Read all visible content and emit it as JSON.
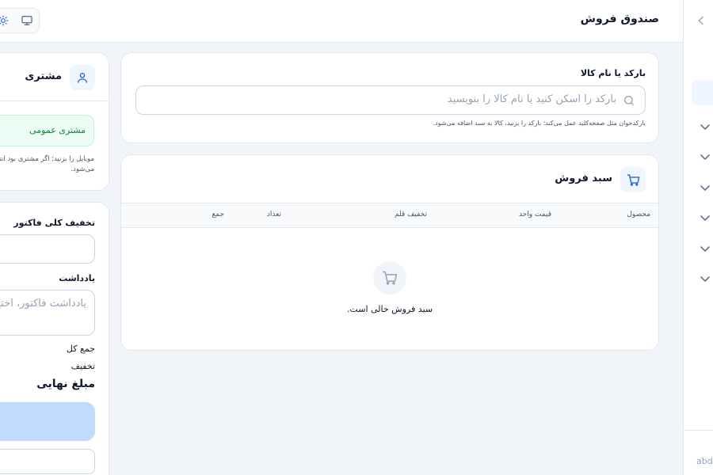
{
  "header": {
    "title": "صندوق فروش",
    "mode_toggle": {
      "desktop_icon": "monitor-icon",
      "theme_icon": "sun-icon"
    }
  },
  "sidebar": {
    "collapse_icon": "chevron-left-icon",
    "group_icons": [
      "chevron-down-icon",
      "chevron-down-icon",
      "chevron-down-icon",
      "chevron-down-icon",
      "chevron-down-icon",
      "chevron-down-icon"
    ],
    "user_label": "abdi"
  },
  "barcode": {
    "label": "بارکد یا نام کالا",
    "placeholder": "بارکد را اسکن کنید یا نام کالا را بنویسید",
    "search_icon": "search-icon",
    "hint": "بارکدخوان مثل صفحه‌کلید عمل می‌کند؛ بارکد را بزنید، کالا به سبد اضافه می‌شود."
  },
  "cart": {
    "title": "سبد فروش",
    "icon": "shopping-cart-icon",
    "columns": {
      "product": "محصول",
      "unit_price": "قیمت واحد",
      "item_discount": "تخفیف قلم",
      "quantity": "تعداد",
      "total": "جمع"
    },
    "empty_text": "سبد فروش خالی است."
  },
  "customer": {
    "title": "مشتری",
    "icon": "user-icon",
    "selected": "مشتری عمومی",
    "hint": "موبایل را بزنید؛ اگر مشتری بود انتخاب می‌شود."
  },
  "summary": {
    "discount_label": "تخفیف کلی فاکتور",
    "note_label": "یادداشت",
    "note_placeholder": "یادداشت فاکتور، اختیاری",
    "subtotal_label": "جمع کل",
    "discount_line_label": "تخفیف",
    "final_label": "مبلغ نهایی"
  },
  "colors": {
    "accent": "#2563eb",
    "accent_soft": "#eff6ff",
    "success_bg": "#ecfdf5",
    "success_text": "#15803d",
    "border": "#e2e8f0",
    "page_bg": "#f1f5f9"
  }
}
